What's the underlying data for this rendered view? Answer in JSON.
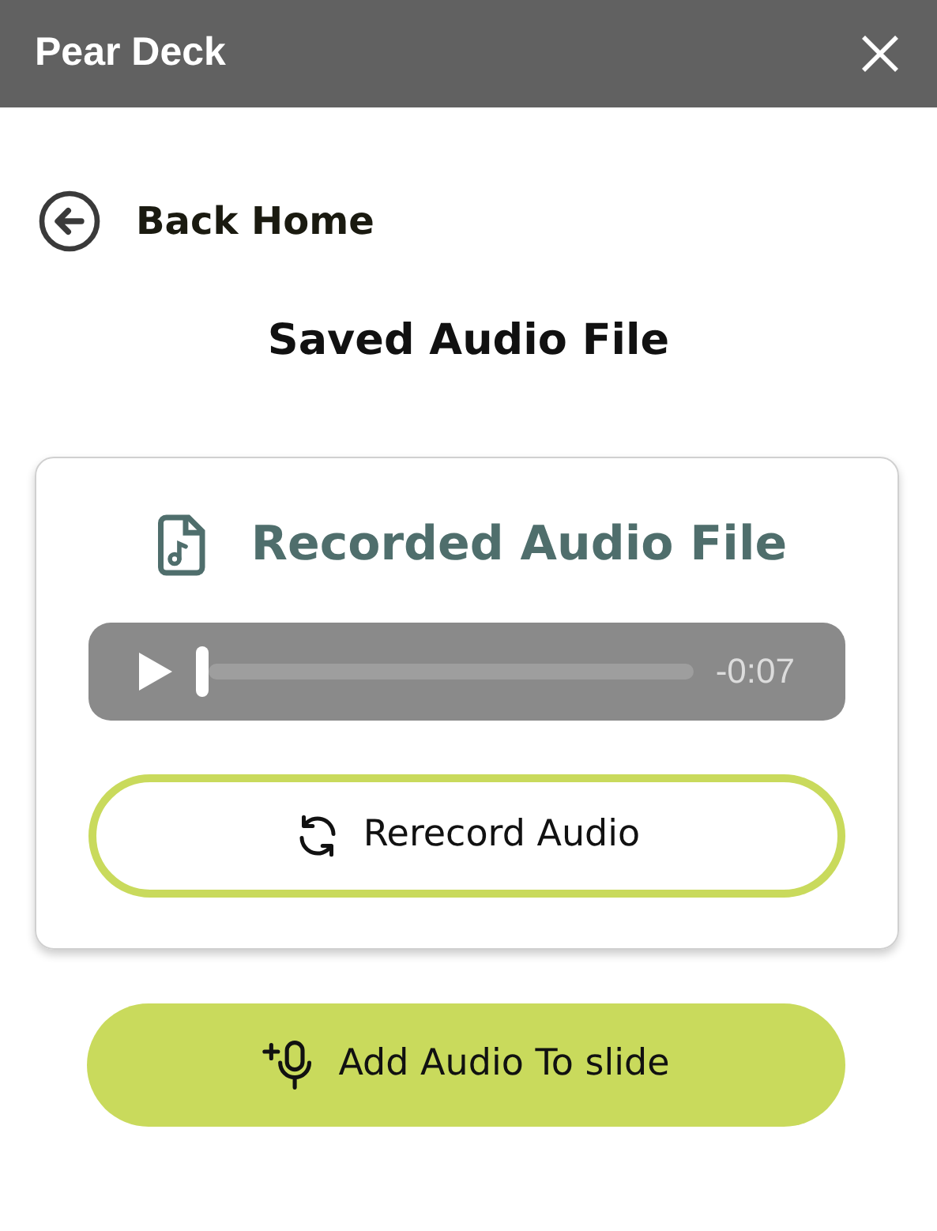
{
  "header": {
    "title": "Pear Deck"
  },
  "back_link": {
    "label": "Back Home"
  },
  "heading": "Saved Audio File",
  "card": {
    "title": "Recorded Audio File",
    "player": {
      "level": 0,
      "time": "-0:07"
    },
    "rerecord_button": "Rerecord Audio"
  },
  "add_button": "Add Audio To slide"
}
